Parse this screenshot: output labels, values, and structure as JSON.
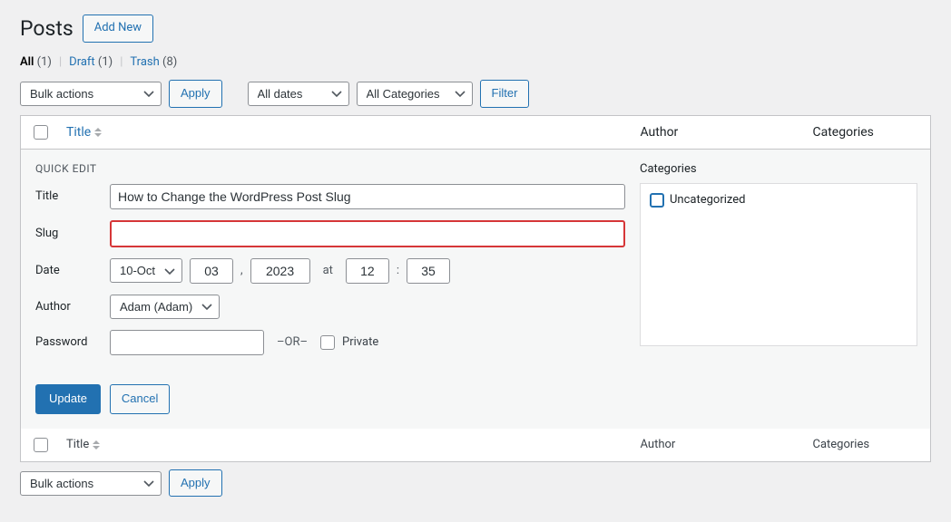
{
  "page": {
    "title": "Posts",
    "add_new": "Add New"
  },
  "filters": {
    "all_label": "All",
    "all_count": "(1)",
    "draft_label": "Draft",
    "draft_count": "(1)",
    "trash_label": "Trash",
    "trash_count": "(8)"
  },
  "toolbar_top": {
    "bulk_actions": "Bulk actions",
    "apply": "Apply",
    "all_dates": "All dates",
    "all_categories": "All Categories",
    "filter": "Filter"
  },
  "columns": {
    "title": "Title",
    "author": "Author",
    "categories": "Categories"
  },
  "quick_edit": {
    "heading": "QUICK EDIT",
    "categories_heading": "Categories",
    "labels": {
      "title": "Title",
      "slug": "Slug",
      "date": "Date",
      "author": "Author",
      "password": "Password"
    },
    "title_value": "How to Change the WordPress Post Slug",
    "slug_value": "",
    "date": {
      "month": "10-Oct",
      "day": "03",
      "year": "2023",
      "at": "at",
      "hour": "12",
      "min": "35",
      "comma": ",",
      "colon": ":"
    },
    "author_value": "Adam (Adam)",
    "password_value": "",
    "or_label": "–OR–",
    "private_label": "Private",
    "category_option": "Uncategorized",
    "update": "Update",
    "cancel": "Cancel"
  },
  "toolbar_bottom": {
    "bulk_actions": "Bulk actions",
    "apply": "Apply"
  }
}
